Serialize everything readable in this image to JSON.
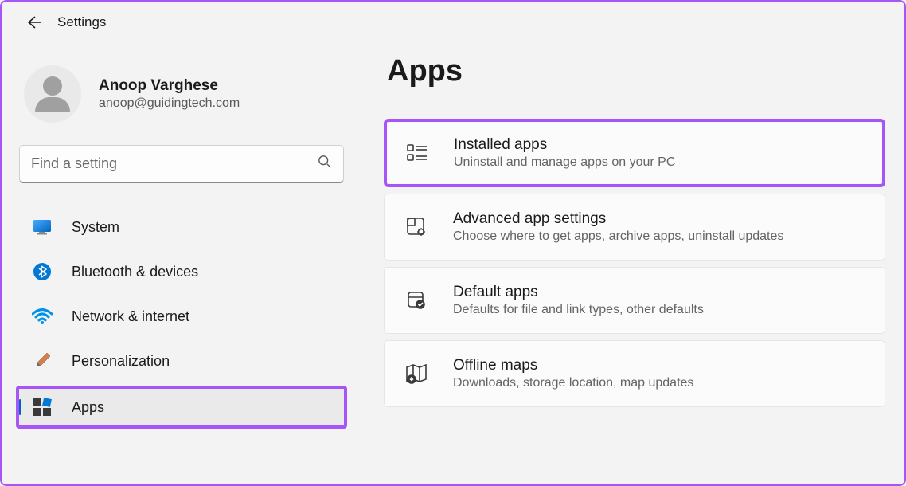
{
  "header": {
    "title": "Settings"
  },
  "profile": {
    "name": "Anoop Varghese",
    "email": "anoop@guidingtech.com"
  },
  "search": {
    "placeholder": "Find a setting"
  },
  "nav": {
    "items": [
      {
        "label": "System",
        "icon": "system"
      },
      {
        "label": "Bluetooth & devices",
        "icon": "bluetooth"
      },
      {
        "label": "Network & internet",
        "icon": "wifi"
      },
      {
        "label": "Personalization",
        "icon": "brush"
      },
      {
        "label": "Apps",
        "icon": "apps",
        "selected": true
      }
    ]
  },
  "main": {
    "title": "Apps",
    "cards": [
      {
        "title": "Installed apps",
        "desc": "Uninstall and manage apps on your PC",
        "icon": "installed",
        "highlighted": true
      },
      {
        "title": "Advanced app settings",
        "desc": "Choose where to get apps, archive apps, uninstall updates",
        "icon": "advanced"
      },
      {
        "title": "Default apps",
        "desc": "Defaults for file and link types, other defaults",
        "icon": "default"
      },
      {
        "title": "Offline maps",
        "desc": "Downloads, storage location, map updates",
        "icon": "maps"
      }
    ]
  }
}
